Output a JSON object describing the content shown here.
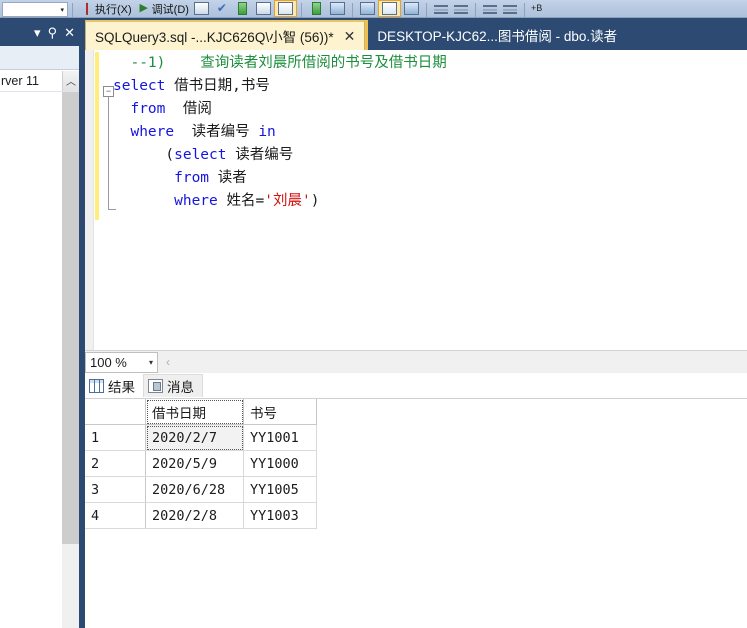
{
  "toolbar": {
    "combo_value": "",
    "items": [
      {
        "name": "execute",
        "label": "执行(X)",
        "icon": "play-icon",
        "highlighted": false
      },
      {
        "name": "debug",
        "label": "调试(D)",
        "icon": "debug-icon",
        "highlighted": false
      },
      {
        "name": "stop",
        "label": "",
        "icon": "stop-icon",
        "highlighted": false
      },
      {
        "name": "parse",
        "label": "",
        "icon": "check-icon",
        "highlighted": false
      },
      {
        "name": "display-estimated-plan",
        "label": "",
        "icon": "estimated-plan-icon",
        "highlighted": false
      },
      {
        "name": "query-options",
        "label": "",
        "icon": "query-options-icon",
        "highlighted": false
      },
      {
        "name": "results-to-grid",
        "label": "",
        "icon": "results-grid-icon",
        "highlighted": true
      },
      {
        "name": "include-actual-plan",
        "label": "",
        "icon": "actual-plan-icon",
        "highlighted": false
      },
      {
        "name": "include-client-statistics",
        "label": "",
        "icon": "client-statistics-icon",
        "highlighted": false
      },
      {
        "name": "results-to-text",
        "label": "",
        "icon": "results-text-icon",
        "highlighted": false
      },
      {
        "name": "results-to-grid-2",
        "label": "",
        "icon": "results-grid2-icon",
        "highlighted": true
      },
      {
        "name": "results-to-file",
        "label": "",
        "icon": "results-file-icon",
        "highlighted": false
      },
      {
        "name": "comment-lines",
        "label": "",
        "icon": "comment-icon",
        "highlighted": false
      },
      {
        "name": "uncomment-lines",
        "label": "",
        "icon": "uncomment-icon",
        "highlighted": false
      },
      {
        "name": "decrease-indent",
        "label": "",
        "icon": "decrease-indent-icon",
        "highlighted": false
      },
      {
        "name": "increase-indent",
        "label": "",
        "icon": "increase-indent-icon",
        "highlighted": false
      },
      {
        "name": "toggle-bookmark",
        "label": "+B",
        "icon": "bookmark-icon",
        "highlighted": false
      }
    ]
  },
  "left_panel": {
    "window_controls": {
      "dropdown": "▾",
      "pin": "⚲",
      "close": "✕"
    },
    "connection_text": "rver 11",
    "scroll_up": "︿"
  },
  "tabs": [
    {
      "label": "SQLQuery3.sql -...KJC626Q\\小智 (56))*",
      "close": "✕",
      "active": true
    },
    {
      "label": "DESKTOP-KJC62...图书借阅 - dbo.读者",
      "close": "",
      "active": false
    }
  ],
  "editor": {
    "outline_toggle": "−",
    "lines": [
      [
        {
          "t": "  --1)    查询读者刘晨所借阅的书号及借书日期",
          "c": "comment"
        }
      ],
      [
        {
          "t": "select",
          "c": "key"
        },
        {
          "t": " 借书日期,书号",
          "c": "id"
        }
      ],
      [
        {
          "t": "  from",
          "c": "key"
        },
        {
          "t": "  借阅",
          "c": "id"
        }
      ],
      [
        {
          "t": "  where",
          "c": "key"
        },
        {
          "t": "  读者编号 ",
          "c": "id"
        },
        {
          "t": "in",
          "c": "key"
        }
      ],
      [
        {
          "t": "      (",
          "c": "punct"
        },
        {
          "t": "select",
          "c": "key"
        },
        {
          "t": " 读者编号",
          "c": "id"
        }
      ],
      [
        {
          "t": "       from",
          "c": "key"
        },
        {
          "t": " 读者",
          "c": "id"
        }
      ],
      [
        {
          "t": "       where",
          "c": "key"
        },
        {
          "t": " 姓名=",
          "c": "id"
        },
        {
          "t": "'刘晨'",
          "c": "str"
        },
        {
          "t": ")",
          "c": "punct"
        }
      ]
    ]
  },
  "zoom_bar": {
    "zoom_value": "100 %",
    "dropdown_arrow": "▾",
    "collapse_chevron": "‹"
  },
  "results_pane": {
    "tabs": [
      {
        "label": "结果",
        "icon": "grid-icon",
        "selected": true
      },
      {
        "label": "消息",
        "icon": "message-icon",
        "selected": false
      }
    ],
    "grid": {
      "columns": [
        "",
        "借书日期",
        "书号"
      ],
      "rows": [
        {
          "num": "1",
          "date": "2020/2/7",
          "book": "YY1001"
        },
        {
          "num": "2",
          "date": "2020/5/9",
          "book": "YY1000"
        },
        {
          "num": "3",
          "date": "2020/6/28",
          "book": "YY1005"
        },
        {
          "num": "4",
          "date": "2020/2/8",
          "book": "YY1003"
        }
      ],
      "selected_cell": {
        "row": 0,
        "column": 1
      }
    }
  },
  "colors": {
    "dock_blue": "#2d4a73",
    "active_tab": "#fdf3cf",
    "change_bar": "#ffee7a",
    "comment_green": "#1c8f3c",
    "keyword_blue": "#1515e0",
    "string_red": "#d41010"
  }
}
